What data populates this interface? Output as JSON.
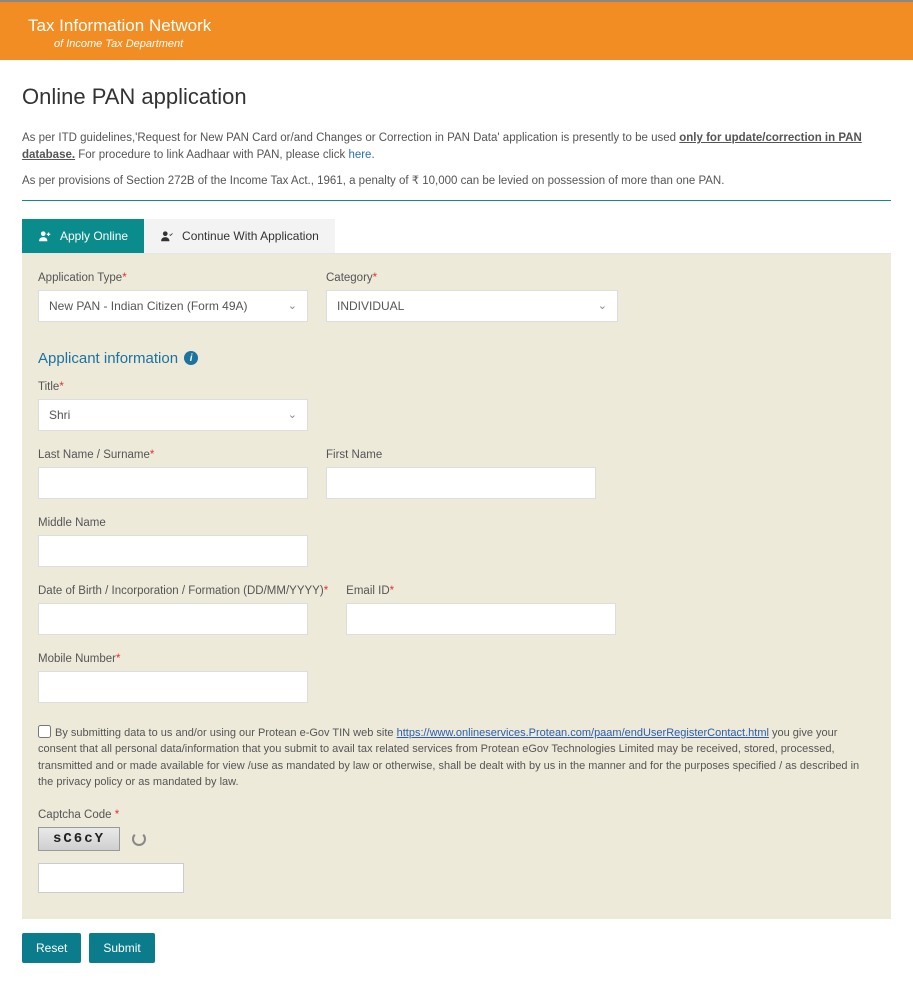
{
  "header": {
    "title": "Tax Information Network",
    "subtitle": "of Income Tax Department"
  },
  "page_title": "Online PAN application",
  "guidelines": {
    "line1_pre": "As per ITD guidelines,'Request for New PAN Card or/and Changes or Correction in PAN Data' application is presently to be used ",
    "line1_underline": "only for update/correction in PAN database.",
    "line1_post": " For procedure to link Aadhaar with PAN, please click ",
    "line1_link": "here",
    "line1_end": ".",
    "line2": "As per provisions of Section 272B of the Income Tax Act., 1961, a penalty of ₹ 10,000 can be levied on possession of more than one PAN."
  },
  "tabs": {
    "apply": "Apply Online",
    "continue": "Continue With Application"
  },
  "form": {
    "app_type_label": "Application Type",
    "app_type_value": "New PAN - Indian Citizen (Form 49A)",
    "category_label": "Category",
    "category_value": "INDIVIDUAL",
    "section_title": "Applicant information",
    "title_label": "Title",
    "title_value": "Shri",
    "last_name_label": "Last Name / Surname",
    "first_name_label": "First Name",
    "middle_name_label": "Middle Name",
    "dob_label": "Date of Birth / Incorporation / Formation (DD/MM/YYYY)",
    "email_label": "Email ID",
    "mobile_label": "Mobile Number",
    "consent_pre": "By submitting data to us and/or using our Protean e-Gov TIN web site ",
    "consent_link": "https://www.onlineservices.Protean.com/paam/endUserRegisterContact.html",
    "consent_post": " you give your consent that all personal data/information that you submit to avail tax related services from Protean eGov Technologies Limited may be received, stored, processed, transmitted and or made available for view /use as mandated by law or otherwise, shall be dealt with by us in the manner and for the purposes specified / as described in the privacy policy or as mandated by law.",
    "captcha_label": "Captcha Code",
    "captcha_value": "sC6cY"
  },
  "buttons": {
    "reset": "Reset",
    "submit": "Submit"
  }
}
